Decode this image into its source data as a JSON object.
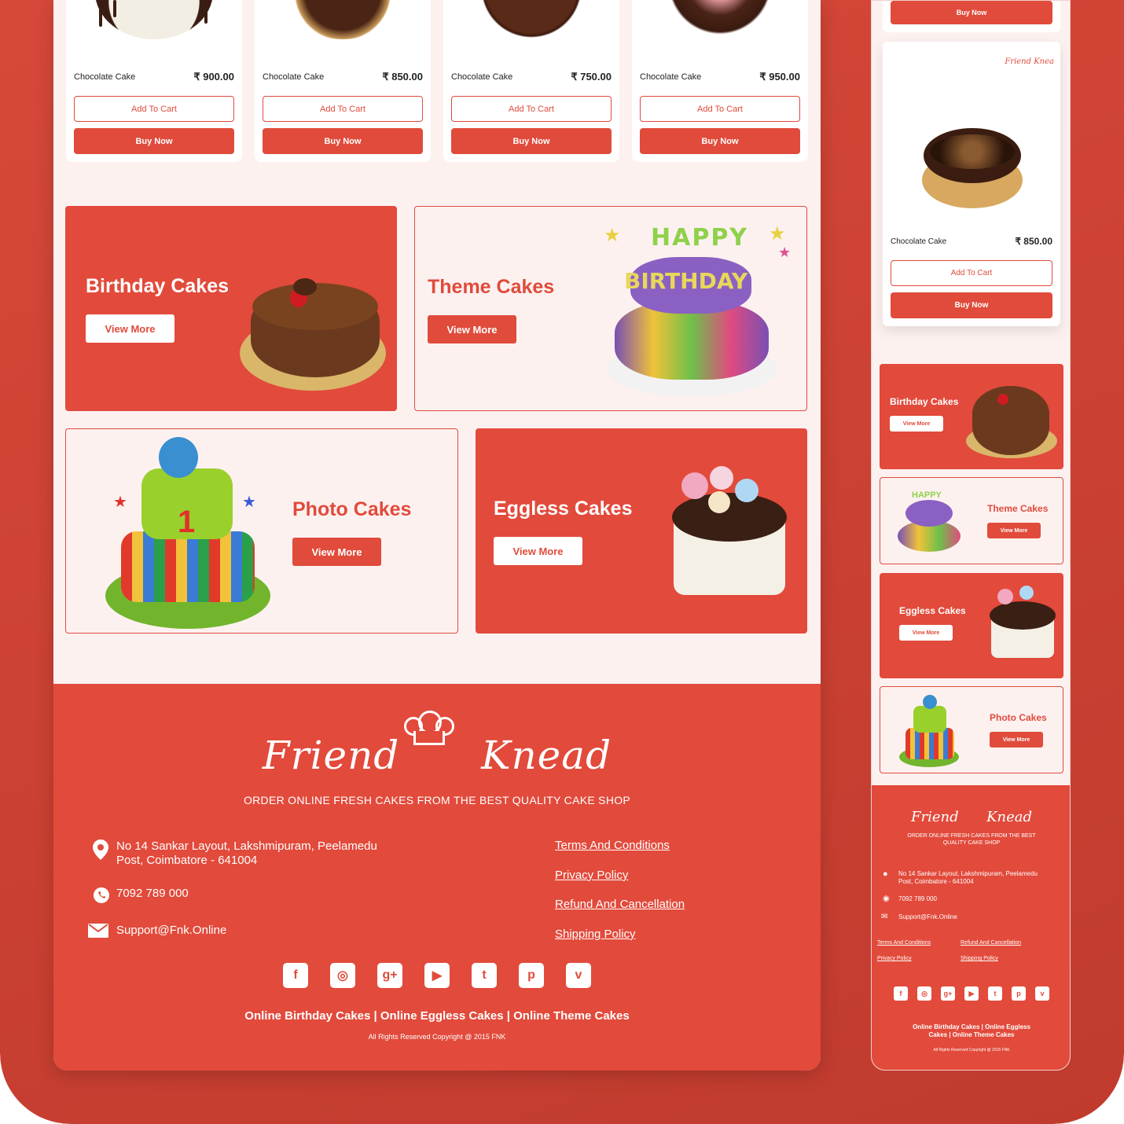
{
  "theme": {
    "accent": "#e24a3b",
    "page_bg": "#fdf1f0",
    "text": "#222222"
  },
  "products": [
    {
      "name": "Chocolate Cake",
      "price": "₹ 900.00",
      "cart_label": "Add To Cart",
      "buy_label": "Buy Now"
    },
    {
      "name": "Chocolate Cake",
      "price": "₹ 850.00",
      "cart_label": "Add To Cart",
      "buy_label": "Buy Now"
    },
    {
      "name": "Chocolate Cake",
      "price": "₹ 750.00",
      "cart_label": "Add To Cart",
      "buy_label": "Buy Now"
    },
    {
      "name": "Chocolate Cake",
      "price": "₹ 950.00",
      "cart_label": "Add To Cart",
      "buy_label": "Buy Now"
    }
  ],
  "categories": [
    {
      "title": "Birthday Cakes",
      "button": "View More"
    },
    {
      "title": "Theme Cakes",
      "button": "View More"
    },
    {
      "title": "Photo Cakes",
      "button": "View More"
    },
    {
      "title": "Eggless Cakes",
      "button": "View More"
    }
  ],
  "footer": {
    "brand_left": "Friend",
    "brand_right": "Knead",
    "tagline": "ORDER ONLINE FRESH CAKES FROM THE BEST QUALITY CAKE SHOP",
    "address": "No 14 Sankar Layout, Lakshmipuram, Peelamedu Post, Coimbatore - 641004",
    "phone": "7092 789 000",
    "email": "Support@Fnk.Online",
    "links": [
      "Terms And Conditions",
      "Privacy Policy",
      "Refund And Cancellation",
      "Shipping Policy"
    ],
    "socials": [
      "f",
      "◎",
      "g+",
      "▶",
      "t",
      "p",
      "v"
    ],
    "bottom_links": "Online Birthday Cakes | Online Eggless Cakes | Online Theme Cakes",
    "copyright": "All Rights Reserved Copyright @ 2015 FNK"
  },
  "mobile": {
    "top_buy": "Buy Now",
    "card_brand": "Friend Knea",
    "card_name": "Chocolate Cake",
    "card_price": "₹ 850.00",
    "card_cart": "Add To Cart",
    "card_buy": "Buy Now",
    "categories": [
      {
        "title": "Birthday Cakes",
        "button": "View More"
      },
      {
        "title": "Theme Cakes",
        "button": "View More"
      },
      {
        "title": "Eggless Cakes",
        "button": "View More"
      },
      {
        "title": "Photo Cakes",
        "button": "View More"
      }
    ]
  }
}
